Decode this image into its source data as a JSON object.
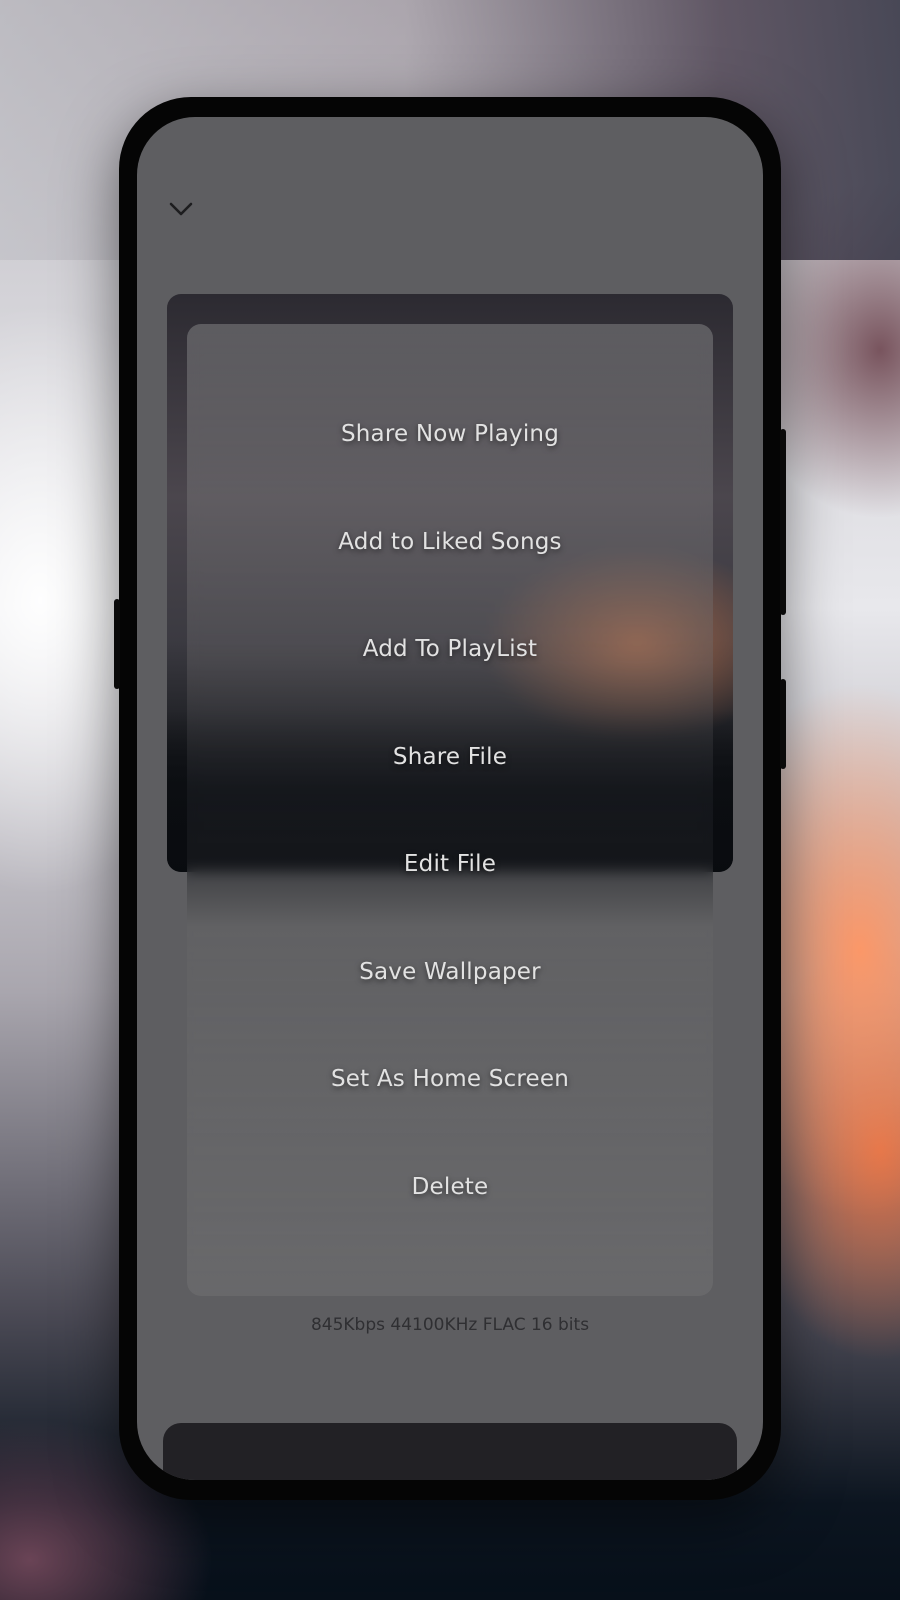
{
  "colors": {
    "screen_background": "#5e5e61",
    "menu_text": "#e2e2e2",
    "info_text": "#2f2f32",
    "bottom_panel": "#222125"
  },
  "header": {
    "collapse_icon": "chevron-down-icon"
  },
  "menu": {
    "items": [
      {
        "label": "Share Now Playing"
      },
      {
        "label": "Add to Liked Songs"
      },
      {
        "label": "Add To PlayList"
      },
      {
        "label": "Share File"
      },
      {
        "label": "Edit File"
      },
      {
        "label": "Save Wallpaper"
      },
      {
        "label": "Set As Home Screen"
      },
      {
        "label": "Delete"
      }
    ]
  },
  "audio_info": "845Kbps 44100KHz FLAC 16 bits"
}
